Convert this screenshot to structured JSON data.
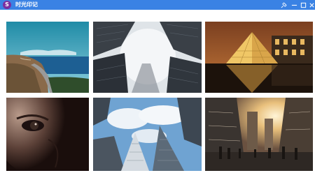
{
  "window": {
    "title": "时光印记",
    "app_icon_letter": "S",
    "app_icon_color": "#7b2fa0",
    "titlebar_color": "#3a82e4",
    "controls": [
      "pin-icon",
      "minimize-icon",
      "maximize-icon",
      "close-icon"
    ]
  },
  "gallery": {
    "photos": [
      {
        "subject": "coastal-road"
      },
      {
        "subject": "skyscrapers-looking-up-fog"
      },
      {
        "subject": "louvre-pyramid-night"
      },
      {
        "subject": "face-eye-closeup"
      },
      {
        "subject": "skyscrapers-looking-up-sky"
      },
      {
        "subject": "city-street-sunset"
      }
    ]
  }
}
